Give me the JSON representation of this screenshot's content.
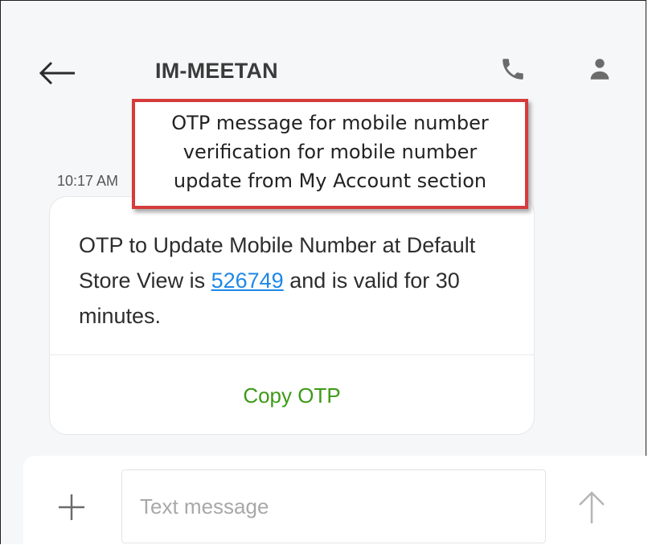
{
  "header": {
    "title": "IM-MEETAN",
    "back_icon": "arrow-left-icon",
    "call_icon": "phone-icon",
    "contact_icon": "person-icon"
  },
  "annotation": {
    "lines": [
      "OTP message for mobile number",
      "verification for mobile number",
      "update from My Account section"
    ],
    "border_color": "#d63b3b"
  },
  "message": {
    "time": "10:17 AM",
    "text_before": "OTP to Update Mobile Number at Default Store View is ",
    "otp": "526749",
    "text_after": " and is valid for 30 minutes.",
    "copy_label": "Copy OTP",
    "link_color": "#1e88e5",
    "action_color": "#3d9a17"
  },
  "composer": {
    "placeholder": "Text message",
    "attach_icon": "plus-icon",
    "send_icon": "arrow-up-icon"
  }
}
